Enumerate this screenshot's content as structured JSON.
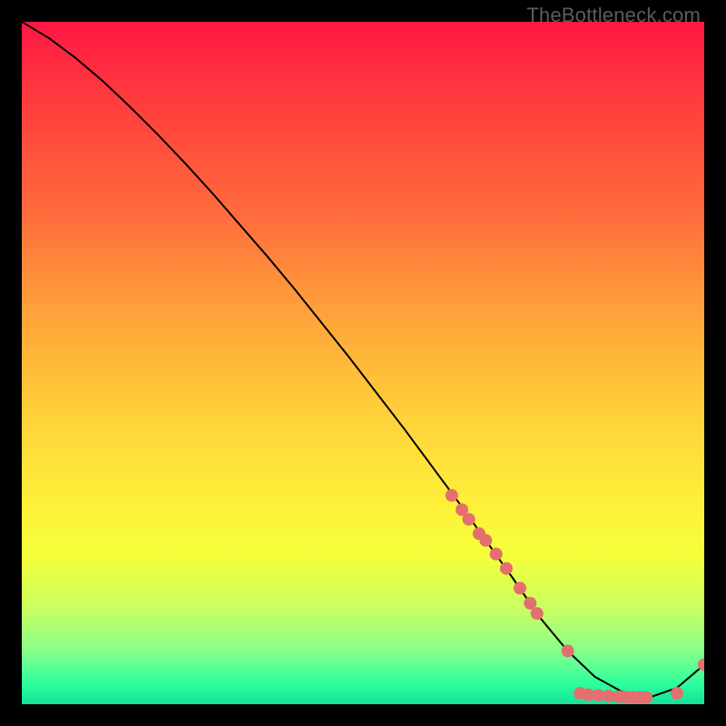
{
  "watermark": "TheBottleneck.com",
  "chart_data": {
    "type": "line",
    "title": "",
    "xlabel": "",
    "ylabel": "",
    "xlim": [
      0,
      100
    ],
    "ylim": [
      0,
      100
    ],
    "grid": false,
    "series": [
      {
        "name": "bottleneck-curve",
        "color": "#000000",
        "x": [
          0,
          4,
          8,
          12,
          16,
          20,
          24,
          28,
          32,
          36,
          40,
          44,
          48,
          52,
          56,
          60,
          64,
          68,
          72,
          76,
          80,
          84,
          88,
          92,
          96,
          100
        ],
        "y": [
          100,
          97.6,
          94.6,
          91.2,
          87.4,
          83.4,
          79.2,
          74.8,
          70.2,
          65.6,
          60.8,
          55.8,
          50.8,
          45.6,
          40.4,
          35.0,
          29.6,
          24.0,
          18.4,
          12.6,
          7.8,
          4.0,
          1.8,
          1.0,
          2.4,
          5.8
        ]
      }
    ],
    "scatter": [
      {
        "name": "curve-markers",
        "color": "#e36f6f",
        "radius_px": 7,
        "points": [
          {
            "x": 63.0,
            "y": 30.6
          },
          {
            "x": 64.5,
            "y": 28.5
          },
          {
            "x": 65.5,
            "y": 27.1
          },
          {
            "x": 67.0,
            "y": 25.0
          },
          {
            "x": 68.0,
            "y": 24.0
          },
          {
            "x": 69.5,
            "y": 22.0
          },
          {
            "x": 71.0,
            "y": 19.9
          },
          {
            "x": 73.0,
            "y": 17.0
          },
          {
            "x": 74.5,
            "y": 14.8
          },
          {
            "x": 75.5,
            "y": 13.3
          },
          {
            "x": 80.0,
            "y": 7.8
          },
          {
            "x": 81.8,
            "y": 1.6
          },
          {
            "x": 83.0,
            "y": 1.4
          },
          {
            "x": 84.5,
            "y": 1.3
          },
          {
            "x": 86.0,
            "y": 1.2
          },
          {
            "x": 87.5,
            "y": 1.1
          },
          {
            "x": 88.5,
            "y": 1.05
          },
          {
            "x": 89.5,
            "y": 1.0
          },
          {
            "x": 90.5,
            "y": 1.0
          },
          {
            "x": 91.5,
            "y": 1.0
          },
          {
            "x": 96.0,
            "y": 1.6
          },
          {
            "x": 100.0,
            "y": 5.8
          }
        ]
      }
    ],
    "background_gradient": {
      "direction": "top-to-bottom",
      "stops": [
        {
          "pos": 0.0,
          "color": "#ff1744"
        },
        {
          "pos": 0.12,
          "color": "#ff3d3d"
        },
        {
          "pos": 0.28,
          "color": "#ff6b3d"
        },
        {
          "pos": 0.42,
          "color": "#ffa03a"
        },
        {
          "pos": 0.58,
          "color": "#ffd23a"
        },
        {
          "pos": 0.7,
          "color": "#ffee3a"
        },
        {
          "pos": 0.78,
          "color": "#f5ff3a"
        },
        {
          "pos": 0.86,
          "color": "#c8ff60"
        },
        {
          "pos": 0.92,
          "color": "#8aff8a"
        },
        {
          "pos": 0.97,
          "color": "#2dff9c"
        },
        {
          "pos": 1.0,
          "color": "#15e09a"
        }
      ]
    }
  }
}
